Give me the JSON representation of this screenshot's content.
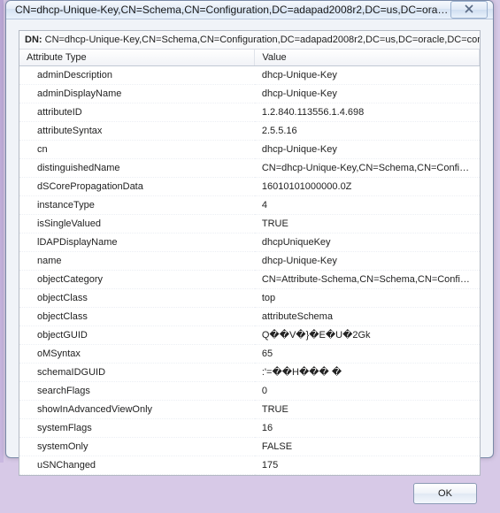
{
  "window": {
    "title": "CN=dhcp-Unique-Key,CN=Schema,CN=Configuration,DC=adapad2008r2,DC=us,DC=oracl..."
  },
  "dn": {
    "label": "DN:",
    "value": "CN=dhcp-Unique-Key,CN=Schema,CN=Configuration,DC=adapad2008r2,DC=us,DC=oracle,DC=com"
  },
  "columns": {
    "attribute": "Attribute Type",
    "value": "Value"
  },
  "rows": [
    {
      "attr": "adminDescription",
      "val": "dhcp-Unique-Key"
    },
    {
      "attr": "adminDisplayName",
      "val": "dhcp-Unique-Key"
    },
    {
      "attr": "attributeID",
      "val": "1.2.840.113556.1.4.698"
    },
    {
      "attr": "attributeSyntax",
      "val": "2.5.5.16"
    },
    {
      "attr": "cn",
      "val": "dhcp-Unique-Key"
    },
    {
      "attr": "distinguishedName",
      "val": "CN=dhcp-Unique-Key,CN=Schema,CN=Configur..."
    },
    {
      "attr": "dSCorePropagationData",
      "val": "16010101000000.0Z"
    },
    {
      "attr": "instanceType",
      "val": "4"
    },
    {
      "attr": "isSingleValued",
      "val": "TRUE"
    },
    {
      "attr": "lDAPDisplayName",
      "val": "dhcpUniqueKey"
    },
    {
      "attr": "name",
      "val": "dhcp-Unique-Key"
    },
    {
      "attr": "objectCategory",
      "val": "CN=Attribute-Schema,CN=Schema,CN=Configur..."
    },
    {
      "attr": "objectClass",
      "val": "top"
    },
    {
      "attr": "objectClass",
      "val": "attributeSchema"
    },
    {
      "attr": "objectGUID",
      "val": "Q��V�}�E�U�2Gk"
    },
    {
      "attr": "oMSyntax",
      "val": "65"
    },
    {
      "attr": "schemaIDGUID",
      "val": ":'=��H���   �"
    },
    {
      "attr": "searchFlags",
      "val": "0"
    },
    {
      "attr": "showInAdvancedViewOnly",
      "val": "TRUE"
    },
    {
      "attr": "systemFlags",
      "val": "16"
    },
    {
      "attr": "systemOnly",
      "val": "FALSE"
    },
    {
      "attr": "uSNChanged",
      "val": "175"
    }
  ],
  "buttons": {
    "ok": "OK"
  }
}
